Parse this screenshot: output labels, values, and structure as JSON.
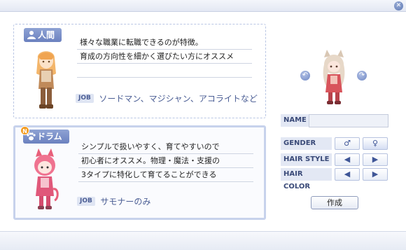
{
  "window": {
    "close_icon": "close-icon"
  },
  "races": {
    "human": {
      "label": "人間",
      "description": [
        "様々な職業に転職できるのが特徴。",
        "育成の方向性を細かく選びたい方にオススメ"
      ],
      "job_tag": "JOB",
      "jobs": "ソードマン、マジシャン、アコライトなど"
    },
    "doram": {
      "badge": "N",
      "label": "ドラム",
      "description": [
        "シンプルで扱いやすく、育てやすいので",
        "初心者にオススメ。物理・魔法・支援の",
        "3タイプに特化して育てることができる"
      ],
      "job_tag": "JOB",
      "jobs": "サモナーのみ"
    }
  },
  "character_options": {
    "name_label": "NAME",
    "name_value": "",
    "gender_label": "GENDER",
    "gender_male": "♂",
    "gender_female": "♀",
    "hair_style_label": "HAIR STYLE",
    "hair_color_label": "HAIR COLOR",
    "prev": "◀",
    "next": "▶"
  },
  "preview": {
    "rotate_left": "↶",
    "rotate_right": "↷"
  },
  "create_button": "作成",
  "colors": {
    "accent": "#6b81bf",
    "panel_border": "#c7d2ec",
    "label_bg": "#e3e8f4"
  }
}
